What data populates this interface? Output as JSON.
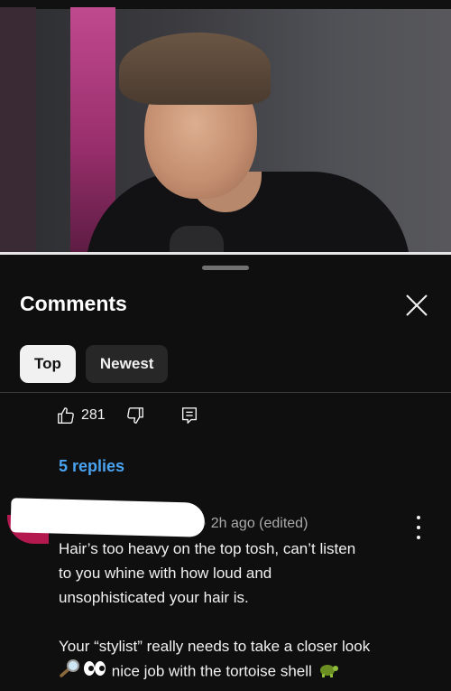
{
  "comments_sheet": {
    "title": "Comments",
    "sort_chips": [
      {
        "label": "Top",
        "selected": true
      },
      {
        "label": "Newest",
        "selected": false
      }
    ]
  },
  "top_comment": {
    "like_count": "281",
    "replies_label": "5 replies"
  },
  "comment": {
    "meta": "· 2h ago (edited)",
    "lines": [
      "Hair’s  too heavy on the top tosh, can’t  listen",
      "to you whine with how loud and",
      "unsophisticated your hair is.",
      "Your “stylist” really needs to take a closer look",
      "nice job  with the tortoise shell"
    ],
    "emojis": [
      "magnifying-glass",
      "eyes",
      "turtle"
    ]
  },
  "colors": {
    "background": "#0f0f0f",
    "link": "#4aa3f0",
    "chip_selected": "#f1f1f1",
    "chip_plain": "#272727"
  }
}
